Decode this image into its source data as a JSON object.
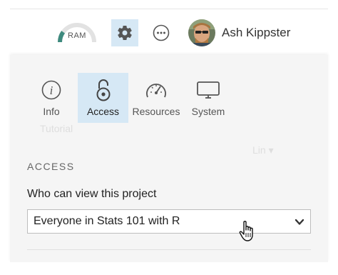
{
  "header": {
    "ram_label": "RAM",
    "ram_usage_fraction": 0.2,
    "user_name": "Ash Kippster"
  },
  "tabs": [
    {
      "id": "info",
      "label": "Info",
      "icon": "info-icon",
      "selected": false
    },
    {
      "id": "access",
      "label": "Access",
      "icon": "lock-icon",
      "selected": true
    },
    {
      "id": "resources",
      "label": "Resources",
      "icon": "speedometer-icon",
      "selected": false
    },
    {
      "id": "system",
      "label": "System",
      "icon": "monitor-icon",
      "selected": false
    }
  ],
  "access": {
    "section_title": "ACCESS",
    "field_label": "Who can view this project",
    "selected_option": "Everyone in Stats 101 with R"
  },
  "colors": {
    "highlight": "#d6e8f5",
    "panel_bg": "#f5f5f5",
    "ram_accent": "#3e8a7e"
  }
}
